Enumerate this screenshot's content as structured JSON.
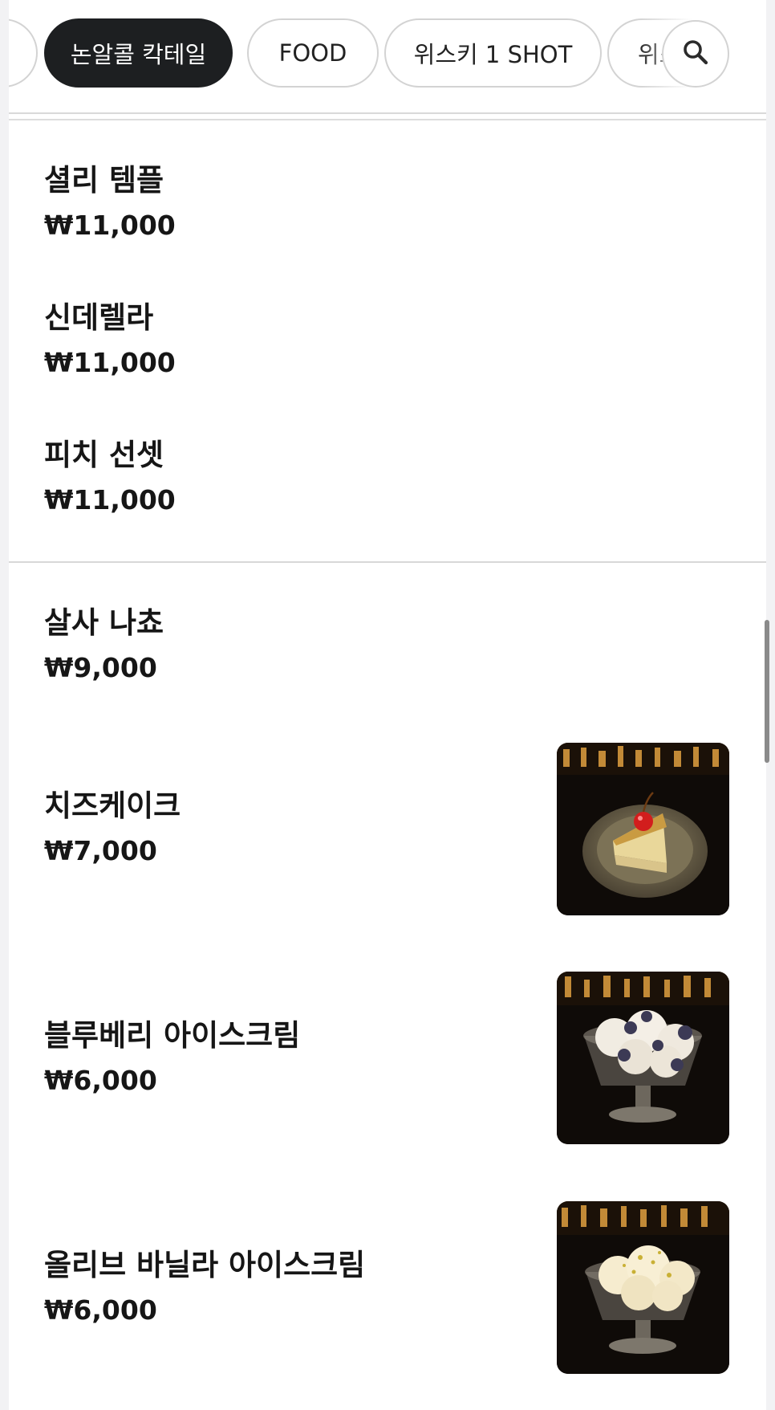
{
  "categories": {
    "items": [
      {
        "label": ""
      },
      {
        "label": "논알콜 칵테일"
      },
      {
        "label": "FOOD"
      },
      {
        "label": "위스키 1 SHOT"
      },
      {
        "label": "위스"
      }
    ],
    "active_index": 1,
    "search_icon": "search-icon"
  },
  "sections": [
    {
      "items": [
        {
          "name": "셜리 템플",
          "price": "₩11,000"
        },
        {
          "name": "신데렐라",
          "price": "₩11,000"
        },
        {
          "name": "피치 선셋",
          "price": "₩11,000"
        }
      ]
    },
    {
      "items": [
        {
          "name": "살사 나쵸",
          "price": "₩9,000"
        },
        {
          "name": "치즈케이크",
          "price": "₩7,000",
          "image": "cheesecake-photo"
        },
        {
          "name": "블루베리 아이스크림",
          "price": "₩6,000",
          "image": "blueberry-ice-cream-photo"
        },
        {
          "name": "올리브 바닐라 아이스크림",
          "price": "₩6,000",
          "image": "olive-vanilla-ice-cream-photo"
        }
      ]
    }
  ],
  "colors": {
    "active_chip": "#1d1f21",
    "text": "#161616",
    "divider": "#d8d8d8",
    "background": "#f2f2f4"
  }
}
